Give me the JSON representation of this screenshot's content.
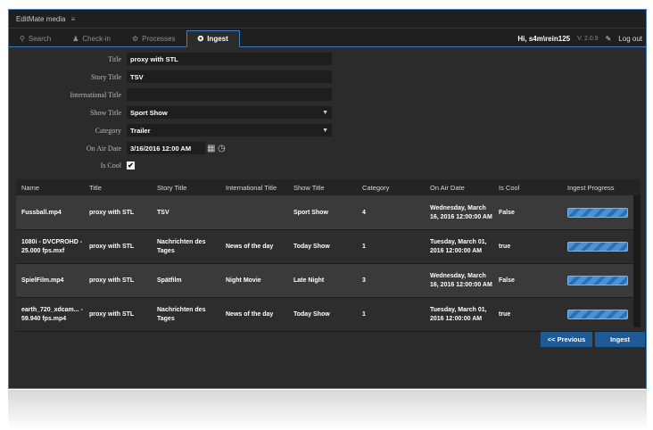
{
  "app": {
    "title": "EditMate media",
    "menu_icon": "≡"
  },
  "tabs": [
    {
      "label": "Search",
      "icon": "search-icon",
      "glyph": "⚲",
      "active": false
    },
    {
      "label": "Check-in",
      "icon": "user-icon",
      "glyph": "♟",
      "active": false
    },
    {
      "label": "Processes",
      "icon": "gears-icon",
      "glyph": "⚙",
      "active": false
    },
    {
      "label": "Ingest",
      "icon": "gear-icon",
      "glyph": "✪",
      "active": true
    }
  ],
  "header_right": {
    "user": "Hi, s4m\\rein125",
    "version": "V. 2.0.9",
    "tool_glyph": "✎",
    "logout": "Log out"
  },
  "form": {
    "title": {
      "label": "Title",
      "value": "proxy with STL"
    },
    "story_title": {
      "label": "Story Title",
      "value": "TSV"
    },
    "international_title": {
      "label": "International Title",
      "value": ""
    },
    "show_title": {
      "label": "Show Title",
      "value": "Sport Show"
    },
    "category": {
      "label": "Category",
      "value": "Trailer"
    },
    "on_air_date": {
      "label": "On Air Date",
      "value": "3/16/2016 12:00 AM"
    },
    "is_cool": {
      "label": "Is Cool",
      "checked": true,
      "check_glyph": "✔"
    }
  },
  "grid": {
    "columns": [
      "Name",
      "Title",
      "Story Title",
      "International Title",
      "Show Title",
      "Category",
      "On Air Date",
      "Is Cool",
      "Ingest Progress"
    ],
    "rows": [
      {
        "name": "Fussball.mp4",
        "title": "proxy with STL",
        "story": "TSV",
        "intl": "",
        "show": "Sport Show",
        "category": "4",
        "date": "Wednesday, March 16, 2016 12:00:00 AM",
        "cool": "False",
        "progress": 1.0
      },
      {
        "name": "1080i - DVCPROHD - 25.000 fps.mxf",
        "title": "proxy with STL",
        "story": "Nachrichten des Tages",
        "intl": "News of the day",
        "show": "Today Show",
        "category": "1",
        "date": "Tuesday, March 01, 2016 12:00:00 AM",
        "cool": "true",
        "progress": 1.0
      },
      {
        "name": "SpielFilm.mp4",
        "title": "proxy with STL",
        "story": "Spätfilm",
        "intl": "Night Movie",
        "show": "Late Night",
        "category": "3",
        "date": "Wednesday, March 16, 2016 12:00:00 AM",
        "cool": "False",
        "progress": 1.0
      },
      {
        "name": "earth_720_xdcam... - 59.940 fps.mp4",
        "title": "proxy with STL",
        "story": "Nachrichten des Tages",
        "intl": "News of the day",
        "show": "Today Show",
        "category": "1",
        "date": "Tuesday, March 01, 2016 12:00:00 AM",
        "cool": "true",
        "progress": 1.0
      }
    ]
  },
  "buttons": {
    "previous": "<< Previous",
    "ingest": "Ingest"
  },
  "colors": {
    "accent": "#3d7fc1",
    "button": "#1f5a94",
    "progress": "#4a92d8"
  }
}
